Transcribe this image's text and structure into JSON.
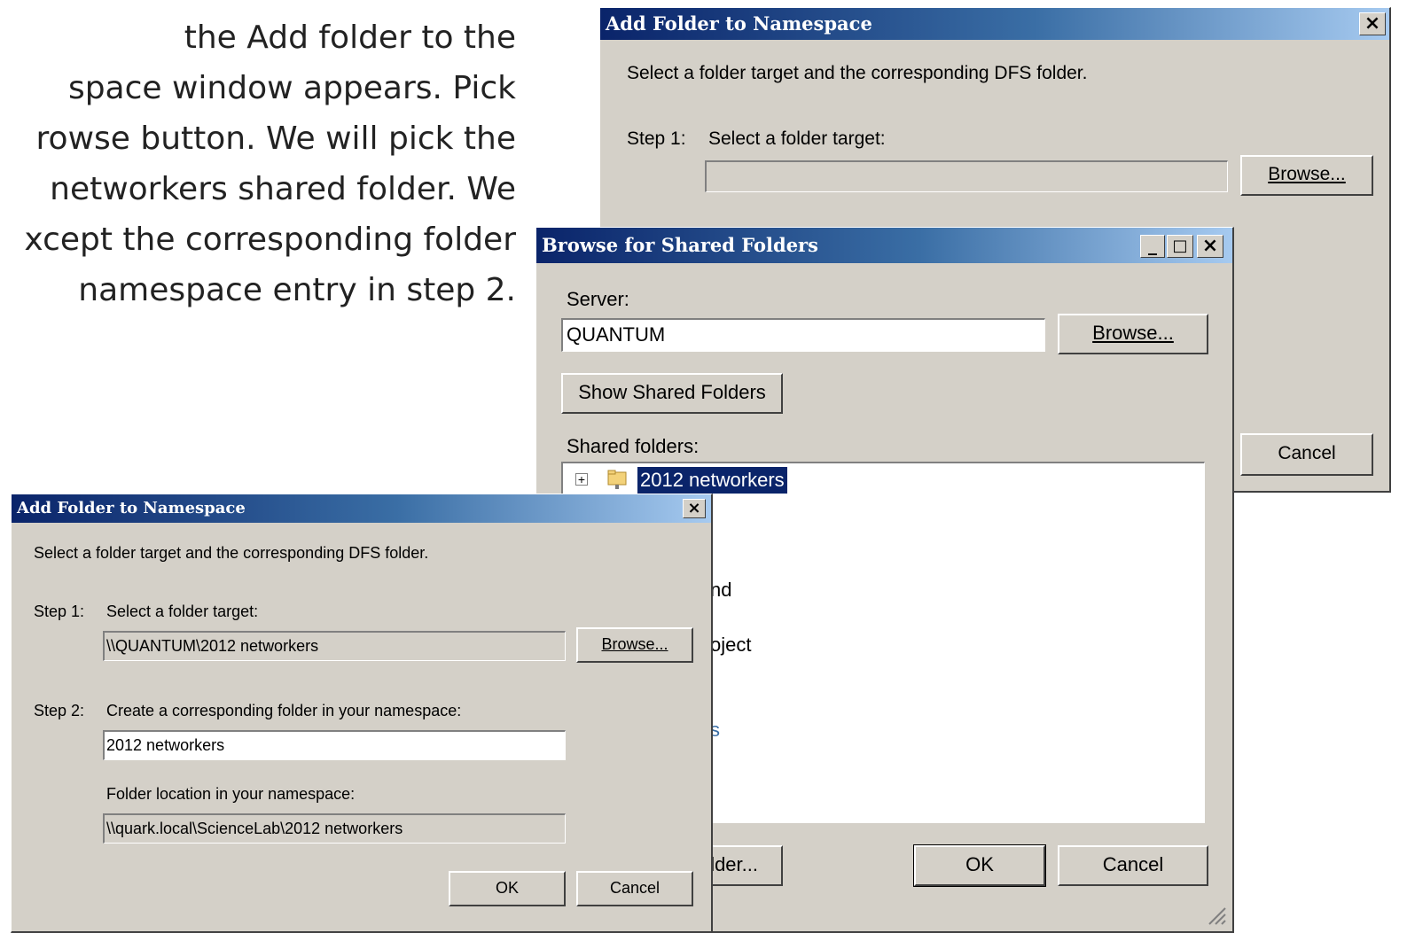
{
  "slide_text": {
    "lines": [
      "the  Add  folder  to  the",
      "space  window  appears.  Pick",
      "rowse button. We will pick the",
      "networkers  shared  folder.  We",
      "xcept the corresponding folder",
      "namespace entry in step 2."
    ]
  },
  "back_dialog": {
    "title": "Add Folder to Namespace",
    "instruction": "Select a folder target and the corresponding DFS folder.",
    "step1_label": "Step 1:",
    "step1_text": "Select a folder target:",
    "step1_value": "",
    "browse_label": "Browse...",
    "cancel_label": "Cancel",
    "close_glyph": "×"
  },
  "browse_dialog": {
    "title": "Browse for Shared Folders",
    "server_label": "Server:",
    "server_value": "QUANTUM",
    "browse_label": "Browse...",
    "show_shared_label": "Show Shared Folders",
    "shared_folders_label": "Shared folders:",
    "tree_items": [
      "2012 networkers"
    ],
    "partial_item_1": "nd",
    "partial_item_2": "oject",
    "partial_item_3": "s",
    "new_folder_partial": "lder...",
    "ok_label": "OK",
    "cancel_label": "Cancel",
    "minimize_glyph": "_",
    "maximize_glyph": "□",
    "close_glyph": "×"
  },
  "front_dialog": {
    "title": "Add Folder to Namespace",
    "instruction": "Select a folder target and the corresponding DFS folder.",
    "step1_label": "Step 1:",
    "step1_text": "Select a folder target:",
    "step1_value": "\\\\QUANTUM\\2012 networkers",
    "browse_label": "Browse...",
    "step2_label": "Step 2:",
    "step2_text": "Create a corresponding folder in your namespace:",
    "step2_value": "2012 networkers",
    "location_label": "Folder location in your namespace:",
    "location_value": "\\\\quark.local\\ScienceLab\\2012 networkers",
    "ok_label": "OK",
    "cancel_label": "Cancel",
    "close_glyph": "×"
  },
  "colors": {
    "dialog_bg": "#d4d0c8",
    "title_start": "#0a246a",
    "title_end": "#a6caf0",
    "selection": "#0a246a"
  }
}
